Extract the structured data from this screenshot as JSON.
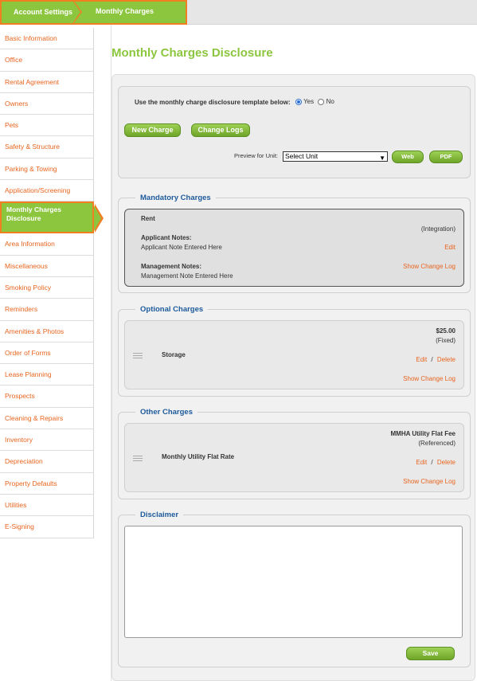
{
  "breadcrumb": {
    "parent": "Account Settings",
    "current": "Monthly Charges"
  },
  "sidebar": {
    "items": [
      "Basic Information",
      "Office",
      "Rental Agreement",
      "Owners",
      "Pets",
      "Safety & Structure",
      "Parking & Towing",
      "Application/Screening",
      "Monthly Charges Disclosure",
      "Area Information",
      "Miscellaneous",
      "Smoking Policy",
      "Reminders",
      "Amenities & Photos",
      "Order of Forms",
      "Lease Planning",
      "Prospects",
      "Cleaning & Repairs",
      "Inventory",
      "Depreciation",
      "Property Defaults",
      "Utilities",
      "E-Signing"
    ],
    "active_index": 8
  },
  "page": {
    "title": "Monthly Charges Disclosure"
  },
  "template": {
    "question": "Use the monthly charge disclosure template below:",
    "yes": "Yes",
    "no": "No",
    "selected": "Yes"
  },
  "buttons": {
    "new_charge": "New Charge",
    "change_logs": "Change Logs",
    "web": "Web",
    "pdf": "PDF",
    "save": "Save"
  },
  "preview": {
    "label": "Preview for Unit:",
    "selected": "Select Unit"
  },
  "mandatory": {
    "legend": "Mandatory Charges",
    "name": "Rent",
    "type": "(Integration)",
    "applicant_label": "Applicant Notes:",
    "applicant_note": "Applicant Note Entered Here",
    "edit": "Edit",
    "management_label": "Management Notes:",
    "management_note": "Management Note Entered Here",
    "show_log": "Show Change Log"
  },
  "optional": {
    "legend": "Optional Charges",
    "name": "Storage",
    "amount": "$25.00",
    "type": "(Fixed)",
    "edit": "Edit",
    "sep": "/",
    "delete": "Delete",
    "show_log": "Show Change Log"
  },
  "other": {
    "legend": "Other Charges",
    "name": "Monthly Utility Flat Rate",
    "amount": "MMHA Utility Flat Fee",
    "type": "(Referenced)",
    "edit": "Edit",
    "sep": "/",
    "delete": "Delete",
    "show_log": "Show Change Log"
  },
  "disclaimer": {
    "legend": "Disclaimer",
    "value": ""
  },
  "colors": {
    "accent": "#8cc63f",
    "highlight": "#f07f22",
    "link": "#e8641e",
    "legend": "#1d5a9c"
  }
}
